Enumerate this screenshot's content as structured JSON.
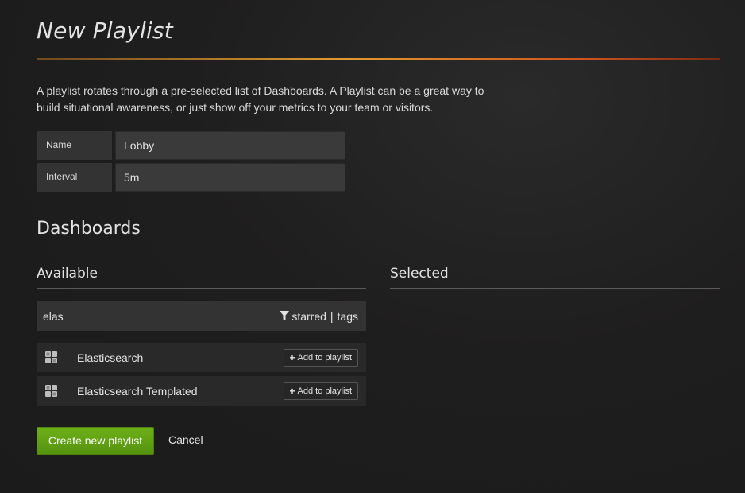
{
  "page": {
    "title": "New Playlist",
    "description": "A playlist rotates through a pre-selected list of Dashboards. A Playlist can be a great way to build situational awareness, or just show off your metrics to your team or visitors."
  },
  "form": {
    "name_label": "Name",
    "name_value": "Lobby",
    "interval_label": "Interval",
    "interval_value": "5m"
  },
  "dashboards": {
    "heading": "Dashboards",
    "available_heading": "Available",
    "selected_heading": "Selected",
    "search_value": "elas",
    "filter_starred": "starred",
    "filter_separator": "|",
    "filter_tags": "tags",
    "available": [
      {
        "title": "Elasticsearch",
        "add_label": "Add to playlist"
      },
      {
        "title": "Elasticsearch Templated",
        "add_label": "Add to playlist"
      }
    ]
  },
  "actions": {
    "create_label": "Create new playlist",
    "cancel_label": "Cancel"
  },
  "colors": {
    "accent_green": "#6cb018",
    "title_rule_orange": "#e29a2e",
    "background": "#1f1e1e"
  },
  "icons": {
    "filter": "filter-icon",
    "dashboard": "dashboard-grid-icon",
    "plus": "plus-icon"
  }
}
